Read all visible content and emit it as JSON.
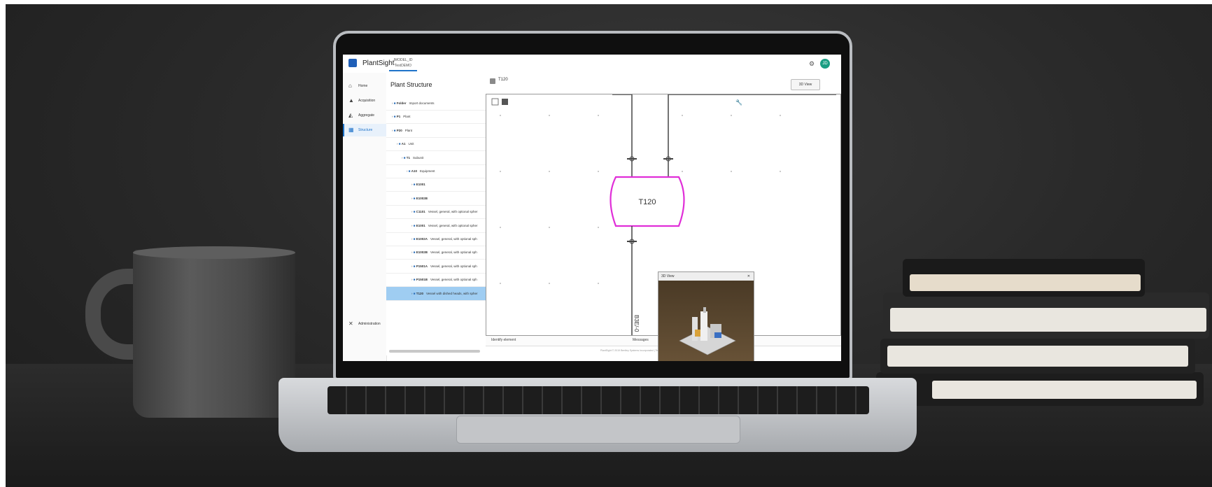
{
  "app": {
    "name": "PlantSight",
    "context_line1": "IMODEL_ID",
    "context_line2": "TestDEMO",
    "avatar_initials": "JD"
  },
  "nav": {
    "items": [
      {
        "label": "Home",
        "icon": "home-icon"
      },
      {
        "label": "Acquisition",
        "icon": "acquisition-icon"
      },
      {
        "label": "Aggregate",
        "icon": "aggregate-icon"
      },
      {
        "label": "Structure",
        "icon": "structure-icon",
        "active": true
      }
    ],
    "admin_label": "Administration"
  },
  "tree": {
    "title": "Plant Structure",
    "rows": [
      {
        "kind": "Folder",
        "text": "Import documents",
        "indent": 0
      },
      {
        "kind": "P1",
        "text": "Plant",
        "indent": 0
      },
      {
        "kind": "P20",
        "text": "Plant",
        "indent": 0
      },
      {
        "kind": "A1",
        "text": "Unit",
        "indent": 1
      },
      {
        "kind": "T1",
        "text": "Subunit",
        "indent": 2
      },
      {
        "kind": "A10",
        "text": "Equipment",
        "indent": 3
      },
      {
        "kind": "E1001",
        "text": "",
        "indent": 4
      },
      {
        "kind": "E1002B",
        "text": "",
        "indent": 4
      },
      {
        "kind": "C1101",
        "text": "Vessel, general, with optional spher",
        "indent": 4
      },
      {
        "kind": "E1001",
        "text": "Vessel, general, with optional spher",
        "indent": 4
      },
      {
        "kind": "E1002A",
        "text": "Vessel, general, with optional sph",
        "indent": 4
      },
      {
        "kind": "E1002B",
        "text": "Vessel, general, with optional sph",
        "indent": 4
      },
      {
        "kind": "P1501A",
        "text": "Vessel, general, with optional sph",
        "indent": 4
      },
      {
        "kind": "P1501B",
        "text": "Vessel, general, with optional sph",
        "indent": 4
      },
      {
        "kind": "T120",
        "text": "Vessel with dished heads, with spher",
        "indent": 4,
        "selected": true
      }
    ]
  },
  "diagram": {
    "title": "T120",
    "button_3d": "3D View",
    "tank_label": "T120",
    "pipe_label": "B3E/-0",
    "status_left": "Identify element",
    "status_right": "Messages",
    "footer": "PlantSight © 2019 Bentley Systems Incorporated | Terms of service | Privacy | Terms of use | Cookies | Legal notices"
  },
  "view3d": {
    "title": "3D View"
  },
  "colors": {
    "accent": "#1f73c9",
    "tank_outline": "#e02ed8",
    "selected_row": "#9fcdf2"
  }
}
